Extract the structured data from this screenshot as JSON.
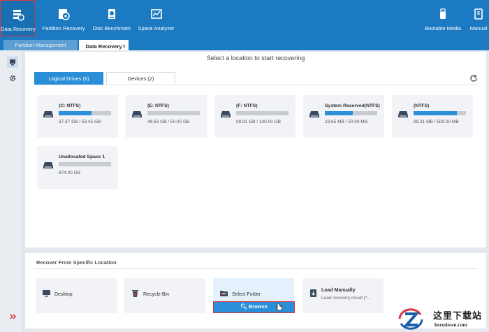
{
  "toolbar": {
    "items": [
      {
        "label": "Data Recovery",
        "icon": "data-recovery-icon",
        "active": true
      },
      {
        "label": "Partition Recovery",
        "icon": "partition-recovery-icon"
      },
      {
        "label": "Disk Benchmark",
        "icon": "disk-benchmark-icon"
      },
      {
        "label": "Space Analyzer",
        "icon": "space-analyzer-icon"
      }
    ],
    "right": [
      {
        "label": "Bootable Media",
        "icon": "usb-icon"
      },
      {
        "label": "Manual",
        "icon": "book-icon"
      }
    ]
  },
  "tabs": [
    {
      "label": "Partition Management",
      "active": false
    },
    {
      "label": "Data Recovery",
      "active": true,
      "close": "×"
    }
  ],
  "main": {
    "title": "Select a location to start recovering",
    "subtabs": [
      {
        "label": "Logical Drives (6)",
        "active": true
      },
      {
        "label": "Devices (2)",
        "active": false
      }
    ],
    "drives": [
      {
        "name": "(C: NTFS)",
        "size": "37.37 GB / 59.45 GB",
        "used": 0.63
      },
      {
        "name": "(E: NTFS)",
        "size": "49.63 GB / 50.00 GB",
        "used": 0.0
      },
      {
        "name": "(F: NTFS)",
        "size": "99.91 GB / 100.00 GB",
        "used": 0.0
      },
      {
        "name": "System Reserved(NTFS)",
        "size": "23.65 MB / 50.00 MB",
        "used": 0.53
      },
      {
        "name": "(NTFS)",
        "size": "88.31 MB / 509.00 MB",
        "used": 0.83
      },
      {
        "name": "Unallocated Space 1",
        "size": "874.00 GB",
        "used": 0.0
      }
    ]
  },
  "locations": {
    "title": "Recover From Specific Location",
    "cards": [
      {
        "label": "Desktop",
        "icon": "desktop-icon"
      },
      {
        "label": "Recycle Bin",
        "icon": "recycle-bin-icon"
      },
      {
        "label": "Select Folder",
        "icon": "folder-icon"
      },
      {
        "label": "Load Manually",
        "sub": "Load recovery result (*...",
        "icon": "load-icon"
      }
    ],
    "browse": "Browse"
  },
  "watermark": {
    "cn": "这里下载站",
    "url": "heredown.com"
  },
  "colors": {
    "brand": "#1b7ac2",
    "accent": "#2a8fd8",
    "highlight": "#d9363e"
  }
}
